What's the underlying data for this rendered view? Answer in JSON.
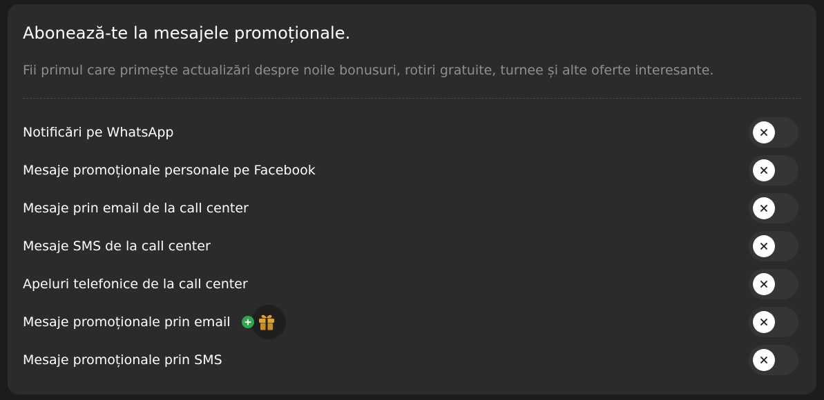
{
  "header": {
    "title": "Abonează-te la mesajele promoționale.",
    "subtitle": "Fii primul care primește actualizări despre noile bonusuri, rotiri gratuite, turnee și alte oferte interesante."
  },
  "settings": [
    {
      "label": "Notificări pe WhatsApp",
      "enabled": false
    },
    {
      "label": "Mesaje promoționale personale pe Facebook",
      "enabled": false
    },
    {
      "label": "Mesaje prin email de la call center",
      "enabled": false
    },
    {
      "label": "Mesaje SMS de la call center",
      "enabled": false
    },
    {
      "label": "Apeluri telefonice de la call center",
      "enabled": false
    },
    {
      "label": "Mesaje promoționale prin email",
      "enabled": false,
      "bonus_icons": [
        "plus-icon",
        "gift-icon"
      ]
    },
    {
      "label": "Mesaje promoționale prin SMS",
      "enabled": false
    }
  ],
  "icons": {
    "toggle_off": "close-icon"
  },
  "colors": {
    "background": "#1c1c1c",
    "card": "#2b2b2b",
    "toggle_track": "#353535",
    "knob": "#ffffff",
    "muted_text": "#8f8f8f",
    "bonus_plus": "#2ea84f",
    "gift": "#e0a526"
  }
}
